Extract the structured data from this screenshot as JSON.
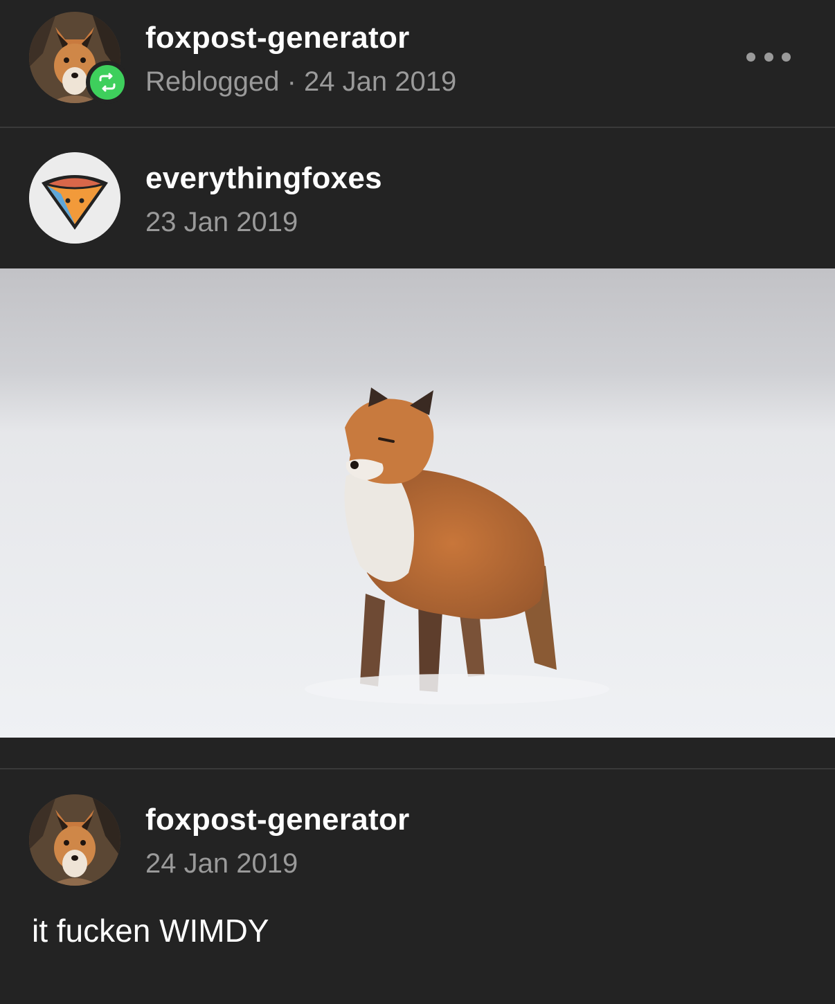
{
  "reblog_header": {
    "username": "foxpost-generator",
    "meta": "Reblogged · 24 Jan 2019",
    "avatar_icon": "fox-avatar-icon",
    "badge_icon": "reblog-icon",
    "badge_color": "#3ecf5c",
    "more_icon": "more-icon"
  },
  "source_post": {
    "username": "everythingfoxes",
    "date": "23 Jan 2019",
    "avatar_icon": "fox-logo-icon"
  },
  "reply": {
    "username": "foxpost-generator",
    "date": "24 Jan 2019",
    "text": "it fucken WIMDY",
    "avatar_icon": "fox-avatar-icon"
  },
  "colors": {
    "background": "#232323",
    "secondary_text": "#9a9a9a",
    "divider": "#3a3a3a"
  }
}
